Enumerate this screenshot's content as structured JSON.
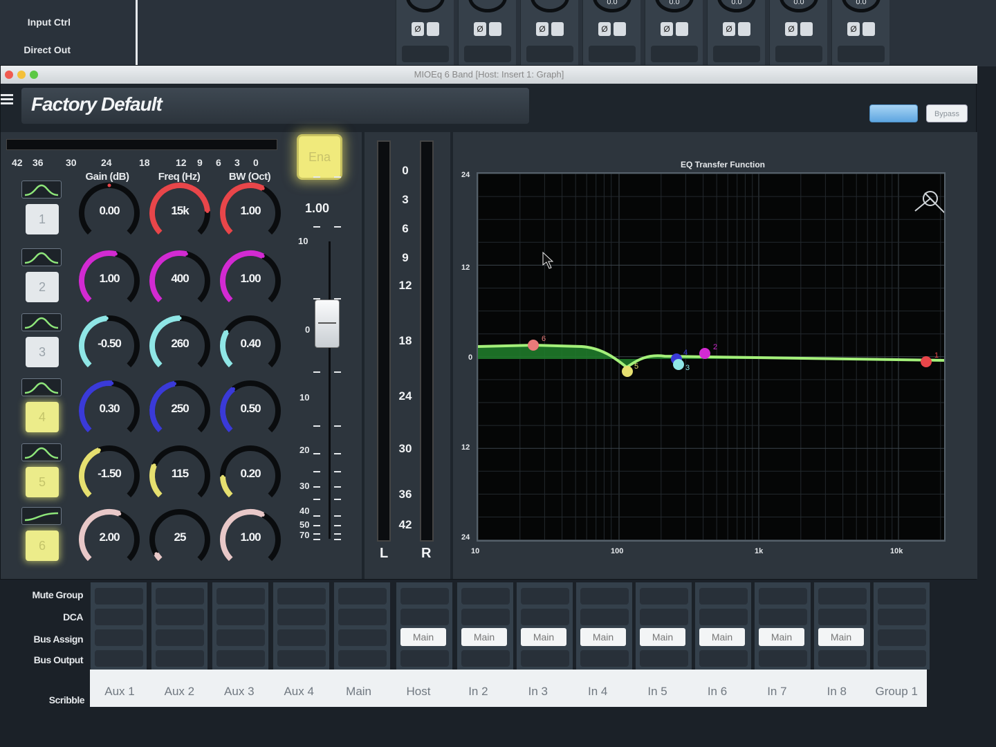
{
  "top_strip": {
    "row_labels": [
      "Input Ctrl",
      "Direct Out"
    ],
    "knob_values": [
      "0.0",
      "0.0",
      "0.0",
      "0.0",
      "0.0",
      "0.0",
      "0.0",
      "0.0"
    ],
    "phase_symbol": "Ø"
  },
  "window": {
    "title": "MIOEq 6 Band [Host: Insert 1: Graph]",
    "preset_name": "Factory Default",
    "bypass_label": "Bypass"
  },
  "left_panel": {
    "meter_scale": [
      "42",
      "36",
      "30",
      "24",
      "18",
      "12",
      "9",
      "6",
      "3",
      "0"
    ],
    "column_headers": {
      "gain": "Gain (dB)",
      "freq": "Freq (Hz)",
      "bw": "BW (Oct)"
    },
    "bands": [
      {
        "number": "1",
        "gain": "0.00",
        "freq": "15k",
        "bw": "1.00",
        "color": "#e8464a",
        "enabled": false
      },
      {
        "number": "2",
        "gain": "1.00",
        "freq": "400",
        "bw": "1.00",
        "color": "#d22ad2",
        "enabled": false
      },
      {
        "number": "3",
        "gain": "-0.50",
        "freq": "260",
        "bw": "0.40",
        "color": "#8fe6e6",
        "enabled": false
      },
      {
        "number": "4",
        "gain": "0.30",
        "freq": "250",
        "bw": "0.50",
        "color": "#3a3ad8",
        "enabled": true
      },
      {
        "number": "5",
        "gain": "-1.50",
        "freq": "115",
        "bw": "0.20",
        "color": "#e6e070",
        "enabled": true
      },
      {
        "number": "6",
        "gain": "2.00",
        "freq": "25",
        "bw": "1.00",
        "color": "#e8c8c8",
        "enabled": true
      }
    ],
    "ena_label": "Ena",
    "fader_value": "1.00",
    "fader_scale": [
      "10",
      "0",
      "10",
      "20",
      "30",
      "40",
      "50",
      "70"
    ]
  },
  "meter_panel": {
    "scale": [
      "0",
      "3",
      "6",
      "9",
      "12",
      "18",
      "24",
      "30",
      "36",
      "42"
    ],
    "left_label": "L",
    "right_label": "R"
  },
  "graph": {
    "title": "EQ Transfer Function",
    "y_labels": [
      "24",
      "12",
      "0",
      "12",
      "24"
    ],
    "x_labels": [
      "10",
      "100",
      "1k",
      "10k"
    ],
    "points": [
      {
        "label": "6",
        "color": "#e87a7a"
      },
      {
        "label": "5",
        "color": "#e6e070"
      },
      {
        "label": "4",
        "color": "#3a3ad8"
      },
      {
        "label": "3",
        "color": "#8fe6e6"
      },
      {
        "label": "2",
        "color": "#d22ad2"
      },
      {
        "label": "1",
        "color": "#e8464a"
      }
    ]
  },
  "mixer": {
    "row_labels": [
      "Mute Group",
      "DCA",
      "Bus Assign",
      "Bus Output",
      "Scribble"
    ],
    "bus_button_label": "Main",
    "scribble": [
      "Aux 1",
      "Aux 2",
      "Aux 3",
      "Aux 4",
      "Main",
      "Host",
      "In 2",
      "In 3",
      "In 4",
      "In 5",
      "In 6",
      "In 7",
      "In 8",
      "Group 1"
    ]
  }
}
